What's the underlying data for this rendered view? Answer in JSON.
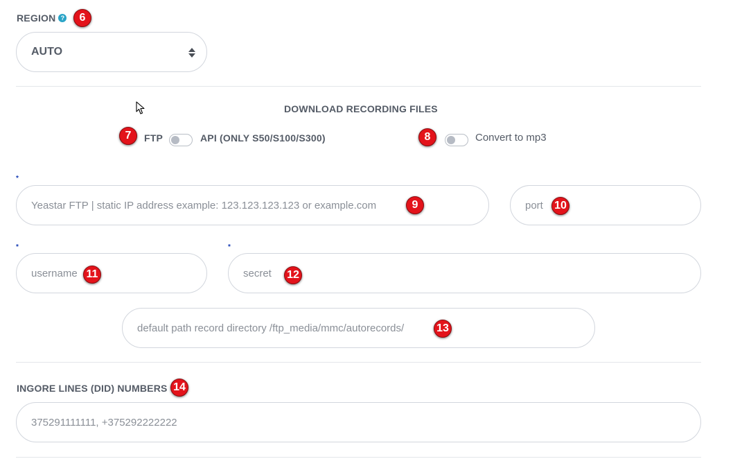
{
  "region": {
    "label": "REGION",
    "help_icon": "question-circle-icon",
    "selected": "AUTO",
    "badge": "6"
  },
  "download": {
    "title": "DOWNLOAD RECORDING FILES",
    "ftp_label": "FTP",
    "api_label": "API (ONLY S50/S100/S300)",
    "badge_mode": "7",
    "convert_label": "Convert to mp3",
    "badge_convert": "8"
  },
  "ftp": {
    "required_mark": "*",
    "host_placeholder": "Yeastar FTP | static IP address example: 123.123.123.123 or example.com",
    "host_badge": "9",
    "port_placeholder": "port",
    "port_badge": "10",
    "username_placeholder": "username",
    "username_badge": "11",
    "secret_placeholder": "secret",
    "secret_badge": "12",
    "path_placeholder": "default path record directory /ftp_media/mmc/autorecords/",
    "path_badge": "13"
  },
  "ignore": {
    "label": "INGORE LINES (DID) NUMBERS",
    "badge": "14",
    "placeholder": "375291111111, +375292222222"
  },
  "colors": {
    "badge_red": "#e3131b",
    "required_star": "#1a3fb5",
    "help_icon": "#2aa4c7"
  }
}
